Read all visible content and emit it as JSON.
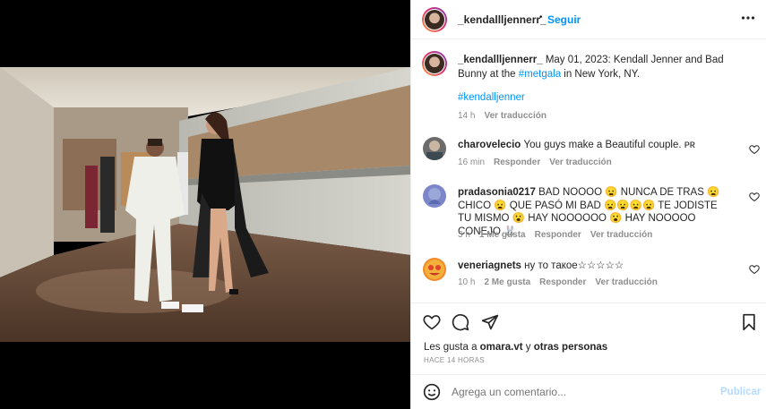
{
  "post": {
    "username": "_kendallljennerr_",
    "follow_label": "Seguir",
    "dot": "•",
    "caption_username": "_kendallljennerr_",
    "caption_pre": "May 01, 2023: Kendall Jenner and Bad Bunny at the ",
    "caption_tag": "#metgala",
    "caption_post": " in New York, NY.",
    "hashtag": "#kendalljenner",
    "caption_time": "14 h",
    "caption_translate": "Ver traducción"
  },
  "comments": [
    {
      "username": "charovelecio",
      "text": "You guys make a Beautiful couple. ᴘʀ",
      "time": "16 min",
      "likes": "",
      "reply": "Responder",
      "translate": "Ver traducción",
      "avatar_color": "#6b6b6b"
    },
    {
      "username": "pradasonia0217",
      "text": "BAD NOOOO 😦 NUNCA DE TRAS 😦 CHICO 😦 QUE PASÓ MI BAD 😦😦😦😦 TE JODISTE TU MISMO 😮 HAY NOOOOOO 😮 HAY NOOOOO CONEJO 🐰",
      "time": "3 h",
      "likes": "1 Me gusta",
      "reply": "Responder",
      "translate": "Ver traducción",
      "avatar_color": "#7d86c9"
    },
    {
      "username": "veneriagnets",
      "text": "ну то такое☆☆☆☆☆",
      "time": "10 h",
      "likes": "2 Me gusta",
      "reply": "Responder",
      "translate": "Ver traducción",
      "avatar_color": "#f08a2a"
    }
  ],
  "likes": {
    "prefix": "Les gusta a ",
    "user": "omara.vt",
    "mid": " y ",
    "others": "otras personas",
    "time": "HACE 14 HORAS"
  },
  "composer": {
    "placeholder": "Agrega un comentario...",
    "publish_label": "Publicar"
  },
  "icons": {
    "more": "more-options-icon",
    "like": "heart-icon",
    "comment": "comment-icon",
    "share": "share-icon",
    "save": "bookmark-icon",
    "emoji": "emoji-icon"
  }
}
